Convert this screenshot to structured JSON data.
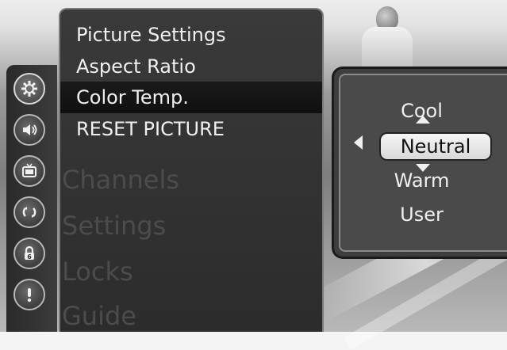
{
  "menu": {
    "items": [
      {
        "label": "Picture Settings",
        "selected": false
      },
      {
        "label": "Aspect Ratio",
        "selected": false
      },
      {
        "label": "Color Temp.",
        "selected": true
      },
      {
        "label": "RESET PICTURE",
        "selected": false
      }
    ],
    "background_labels": [
      "Channels",
      "Settings",
      "Locks",
      "Guide"
    ]
  },
  "sidebar": {
    "icons": [
      {
        "name": "gear-icon",
        "active": true
      },
      {
        "name": "speaker-icon",
        "active": false
      },
      {
        "name": "tv-icon",
        "active": false
      },
      {
        "name": "arrows-cycle-icon",
        "active": false
      },
      {
        "name": "lock-icon",
        "active": false
      },
      {
        "name": "exclamation-icon",
        "active": false
      }
    ]
  },
  "color_temp": {
    "options": [
      "Cool",
      "Neutral",
      "Warm",
      "User"
    ],
    "selected": "Neutral"
  },
  "colors": {
    "menu_bg": "#363636",
    "highlight": "#111111",
    "text": "#f0f0f0"
  }
}
